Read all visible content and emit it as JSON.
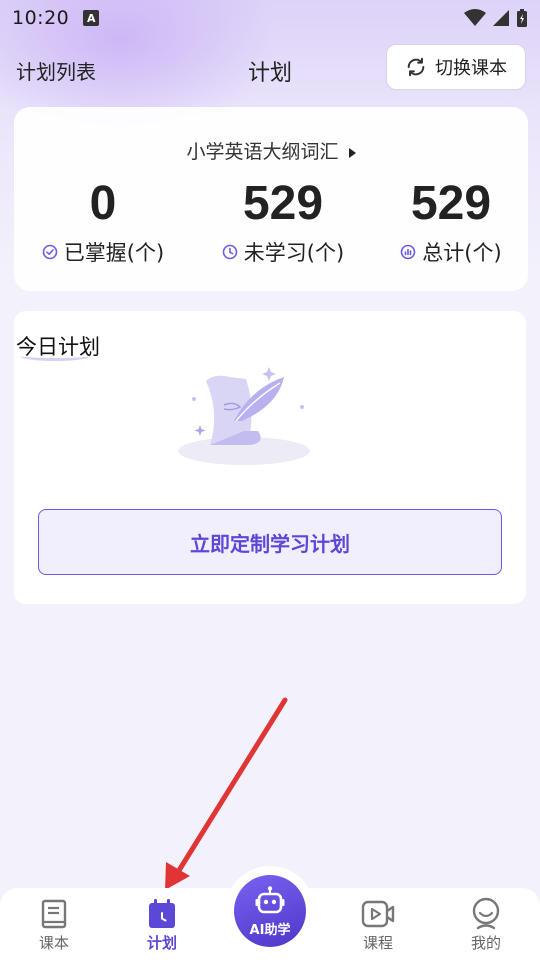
{
  "status_bar": {
    "time": "10:20",
    "notification_glyph": "A"
  },
  "header": {
    "plan_list_label": "计划列表",
    "title": "计划",
    "switch_button_label": "切换课本"
  },
  "stats": {
    "book_name": "小学英语大纲词汇",
    "items": [
      {
        "value": "0",
        "label": "已掌握(个)",
        "icon": "check-circle-icon"
      },
      {
        "value": "529",
        "label": "未学习(个)",
        "icon": "clock-icon"
      },
      {
        "value": "529",
        "label": "总计(个)",
        "icon": "chart-circle-icon"
      }
    ]
  },
  "today": {
    "title": "今日计划",
    "button_label": "立即定制学习计划"
  },
  "bottom_nav": {
    "items": [
      {
        "label": "课本",
        "icon": "book-icon",
        "active": false
      },
      {
        "label": "计划",
        "icon": "calendar-icon",
        "active": true
      },
      {
        "label": "AI助学",
        "icon": "robot-icon",
        "active": false
      },
      {
        "label": "课程",
        "icon": "video-icon",
        "active": false
      },
      {
        "label": "我的",
        "icon": "profile-icon",
        "active": false
      }
    ]
  },
  "colors": {
    "accent": "#5b48d6",
    "annotation_arrow": "#e03535"
  }
}
